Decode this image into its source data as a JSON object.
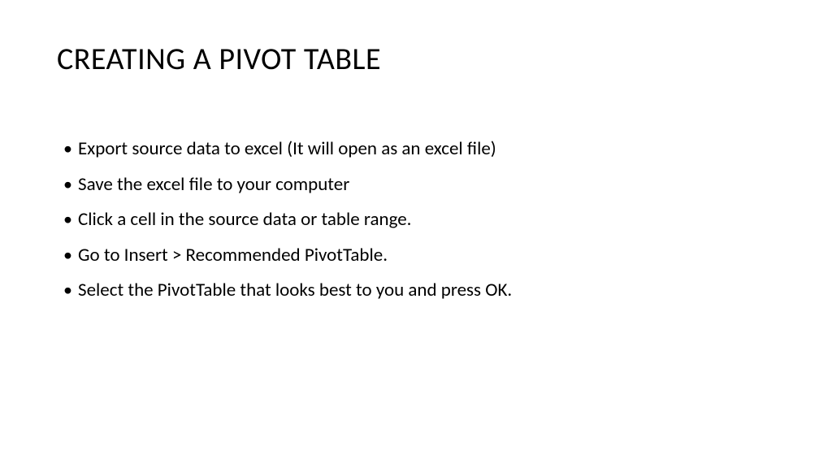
{
  "slide": {
    "title": "CREATING A PIVOT TABLE",
    "bullets": [
      "Export source data to excel (It will open as an excel file)",
      "Save the excel file to your computer",
      "Click a cell in the source data or table range.",
      "Go to Insert > Recommended PivotTable.",
      "Select the PivotTable that looks best to you and press OK."
    ]
  }
}
